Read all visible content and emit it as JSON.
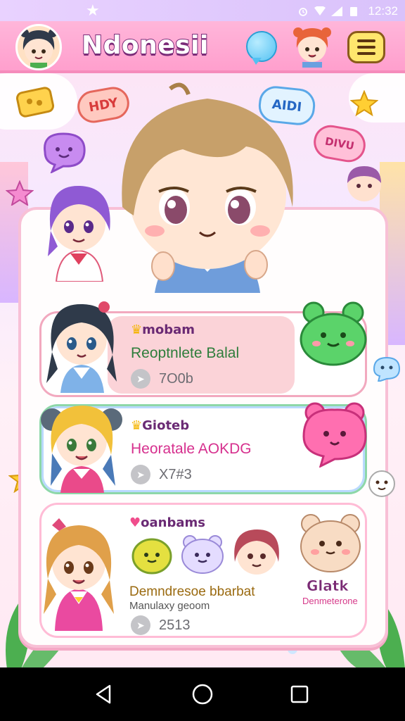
{
  "status_bar": {
    "time": "12:32"
  },
  "app_bar": {
    "title": "Ndonesii"
  },
  "decor": {
    "bubble_left": "HDY",
    "bubble_right": "AIDI",
    "bubble_far_right": "DIVU"
  },
  "list": [
    {
      "tag": "mobam",
      "title": "Reoptnlete Balal",
      "meta": "7O0b",
      "tag_icon": "crown-icon",
      "title_color": "#2e7d3b"
    },
    {
      "tag": "Gioteb",
      "title": "Heoratale AOKDG",
      "meta": "X7#3",
      "tag_icon": "crown-icon",
      "title_color": "#d6308e"
    },
    {
      "tag": "oanbams",
      "title": "Demndresoe bbarbat",
      "subtitle": "Manulaxy geoom",
      "meta": "2513",
      "tag_icon": "heart-icon",
      "title_color": "#9a6a10"
    }
  ],
  "side_card": {
    "title": "Glatk",
    "subtitle": "Denmeterone"
  },
  "colors": {
    "accent": "#ff9fcd",
    "title_stroke": "#7a2b78"
  }
}
